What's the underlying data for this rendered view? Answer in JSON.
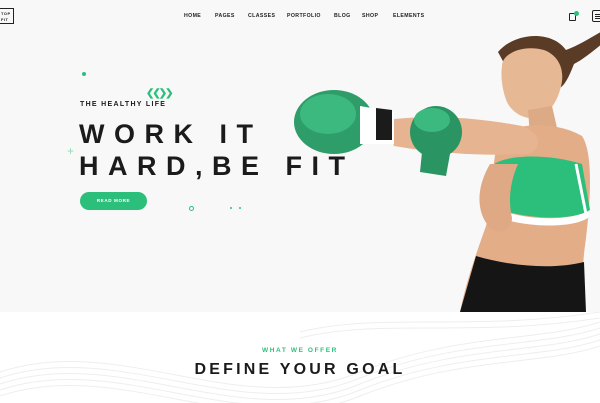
{
  "brand": {
    "logo_line1": "TOP",
    "logo_line2": "FIT"
  },
  "nav": {
    "items": [
      "HOME",
      "PAGES",
      "CLASSES",
      "PORTFOLIO",
      "BLOG",
      "SHOP",
      "ELEMENTS"
    ],
    "cart_icon": "shopping-bag-icon",
    "menu_icon": "menu-icon"
  },
  "hero": {
    "subtitle": "THE HEALTHY LIFE",
    "headline_line1": "WORK IT",
    "headline_line2": "HARD,BE FIT",
    "cta_label": "READ MORE"
  },
  "offer": {
    "subtitle": "WHAT WE OFFER",
    "title": "DEFINE YOUR GOAL"
  },
  "colors": {
    "accent": "#2cbf7c",
    "text": "#1b1b1b",
    "hero_bg": "#f8f8f8"
  }
}
